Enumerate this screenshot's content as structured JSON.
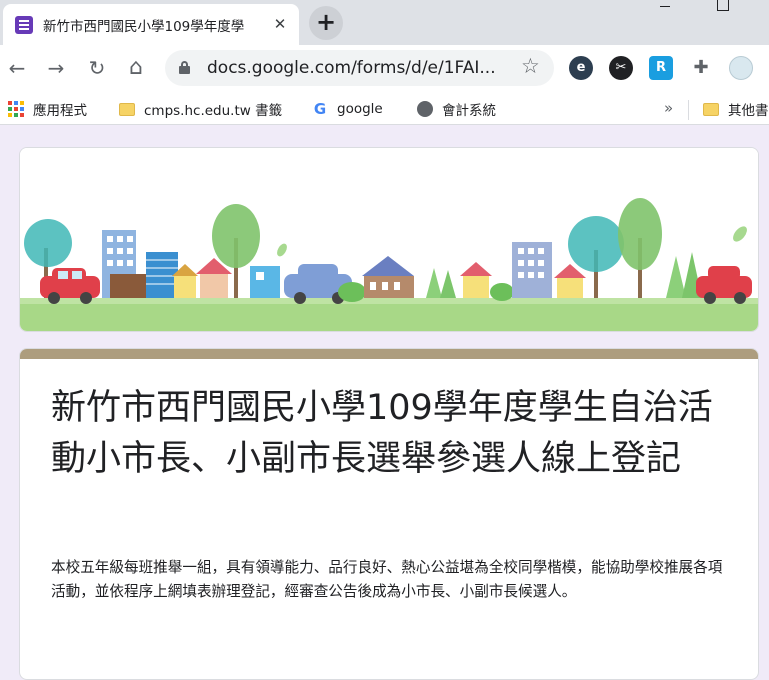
{
  "browser": {
    "tab_title": "新竹市西門國民小學109學年度學",
    "tab_close": "✕",
    "new_tab": "+",
    "url": "docs.google.com/forms/d/e/1FAI...",
    "nav": {
      "back": "←",
      "forward": "→",
      "reload": "↻",
      "home": "⌂",
      "star": "☆"
    },
    "extensions": [
      {
        "name": "edge-extension-icon",
        "glyph": "e"
      },
      {
        "name": "scissors-extension-icon",
        "glyph": "✂"
      },
      {
        "name": "r-extension-icon",
        "glyph": "R"
      },
      {
        "name": "puzzle-icon",
        "glyph": "✚"
      },
      {
        "name": "profile-avatar",
        "glyph": ""
      }
    ]
  },
  "bookmarks": {
    "items": [
      {
        "label": "應用程式",
        "icon": "apps-icon"
      },
      {
        "label": "cmps.hc.edu.tw 書籤",
        "icon": "folder-icon"
      },
      {
        "label": "google",
        "icon": "google-icon"
      },
      {
        "label": "會計系統",
        "icon": "globe-icon"
      }
    ],
    "overflow": "»",
    "other": "其他書"
  },
  "form": {
    "title": "新竹市西門國民小學109學年度學生自治活動小市長、小副市長選舉參選人線上登記",
    "description": "本校五年級每班推舉一組，具有領導能力、品行良好、熱心公益堪為全校同學楷模，能協助學校推展各項活動，並依程序上網填表辦理登記，經審查公告後成為小市長、小副市長候選人。"
  },
  "colors": {
    "theme": "#673ab7",
    "header_bar": "#ad9d7e",
    "page_bg": "#f0ebf8"
  }
}
